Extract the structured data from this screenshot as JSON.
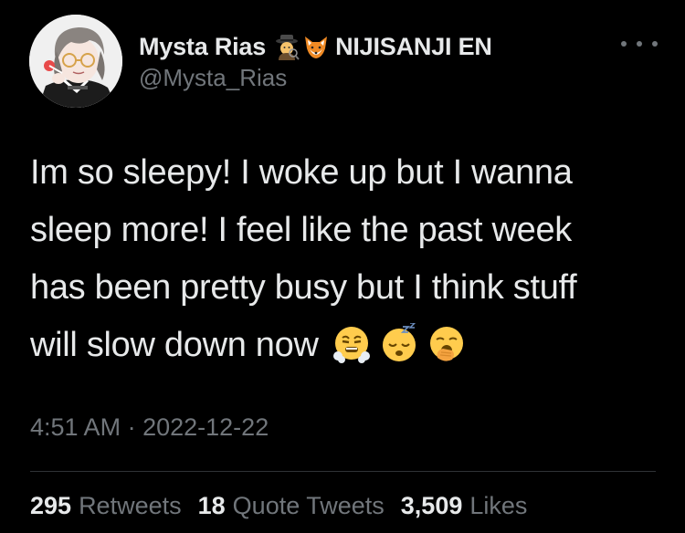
{
  "author": {
    "display_name": "Mysta Rias",
    "name_emojis": [
      "detective-emoji",
      "fox-emoji"
    ],
    "affiliation": "NIJISANJI EN",
    "handle": "@Mysta_Rias",
    "avatar_icon": "avatar-portrait"
  },
  "tweet": {
    "lines": [
      "Im so sleepy! I woke up but I wanna",
      "sleep more! I feel like the past week",
      "has been pretty busy but I think stuff",
      "will slow down now"
    ],
    "trailing_emojis": [
      "face-with-steam-emoji",
      "sleeping-face-emoji",
      "yawning-face-emoji"
    ]
  },
  "meta": {
    "time": "4:51 AM",
    "separator": "·",
    "date": "2022-12-22"
  },
  "stats": {
    "retweets_count": "295",
    "retweets_label": "Retweets",
    "quotes_count": "18",
    "quotes_label": "Quote Tweets",
    "likes_count": "3,509",
    "likes_label": "Likes"
  },
  "colors": {
    "background": "#000000",
    "primary_text": "#e7e9ea",
    "secondary_text": "#71767b",
    "divider": "#2f3336"
  }
}
